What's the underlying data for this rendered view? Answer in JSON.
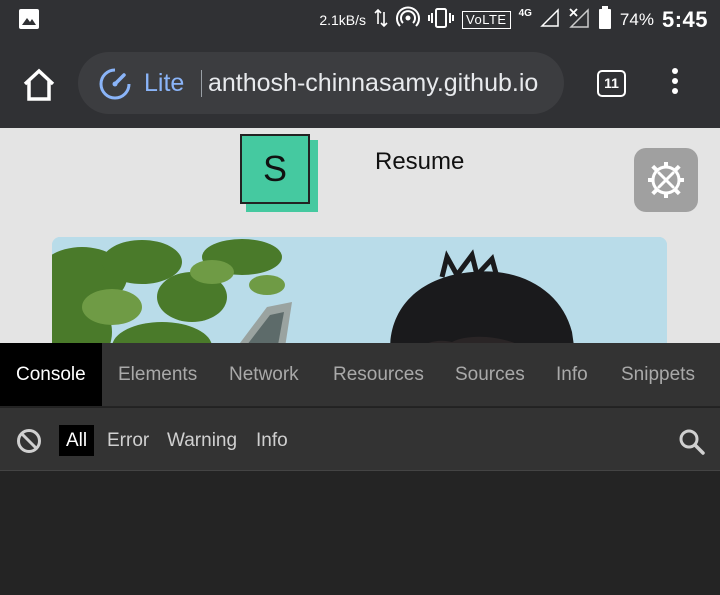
{
  "status_bar": {
    "net_speed": "2.1kB/s",
    "volte": "VoLTE",
    "network_type": "4G",
    "battery_percent": "74%",
    "time": "5:45",
    "icons": [
      "image-icon",
      "data-transfer-icon",
      "hotspot-icon",
      "vibrate-icon",
      "volte-icon",
      "signal-icon",
      "no-signal-icon",
      "battery-icon"
    ]
  },
  "toolbar": {
    "lite_label": "Lite",
    "url": "anthosh-chinnasamy.github.io",
    "tab_count": "11",
    "icons": [
      "home-icon",
      "lite-mode-icon",
      "tab-switcher-icon",
      "more-vert-icon"
    ]
  },
  "page": {
    "logo_letter": "S",
    "resume_link": "Resume",
    "accent_color": "#45c9a0",
    "icons": [
      "settings-tools-icon"
    ]
  },
  "devtools": {
    "tabs": [
      "Console",
      "Elements",
      "Network",
      "Resources",
      "Sources",
      "Info",
      "Snippets"
    ],
    "active_tab": "Console",
    "filters": [
      "All",
      "Error",
      "Warning",
      "Info"
    ],
    "active_filter": "All",
    "icons": [
      "clear-console-icon",
      "search-icon"
    ]
  }
}
